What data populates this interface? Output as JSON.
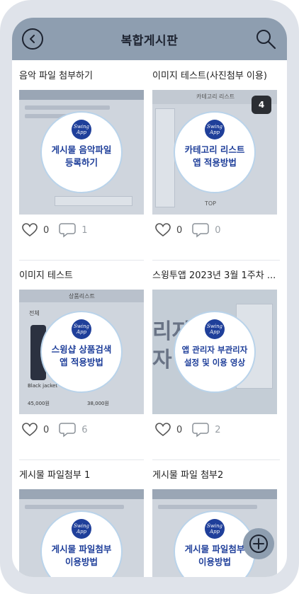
{
  "header": {
    "title": "복합게시판"
  },
  "posts": [
    {
      "title": "음악 파일 첨부하기",
      "badge_line1": "게시물 음악파일",
      "badge_line2": "등록하기",
      "likes": "0",
      "comments": "1",
      "count": ""
    },
    {
      "title": "이미지 테스트(사진첨부 이용)",
      "badge_line1": "카테고리 리스트",
      "badge_line2": "앱 적용방법",
      "likes": "0",
      "comments": "0",
      "count": "4"
    },
    {
      "title": "이미지 테스트",
      "badge_line1": "스윙샵 상품검색",
      "badge_line2": "앱 적용방법",
      "likes": "0",
      "comments": "6",
      "count": ""
    },
    {
      "title": "스윙투앱 2023년 3월 1주차 ...",
      "badge_line1": "앱 관리자 부관리자",
      "badge_line2": "설정 및 이용 영상",
      "likes": "0",
      "comments": "2",
      "count": ""
    },
    {
      "title": "게시물 파일첨부 1",
      "badge_line1": "게시물 파일첨부",
      "badge_line2": "이용방법",
      "likes": "",
      "comments": "",
      "count": ""
    },
    {
      "title": "게시물 파일 첨부2",
      "badge_line1": "게시물 파일첨부",
      "badge_line2": "이용방법",
      "likes": "",
      "comments": "",
      "count": ""
    }
  ],
  "logo": {
    "line1": "Swing",
    "line2": "App"
  },
  "thumb_texts": {
    "category_list": "카테고리 리스트",
    "top": "TOP",
    "product_list": "상품리스트",
    "all": "전체",
    "black_jacket": "Black jacket",
    "price1": "45,000원",
    "price2": "38,000원"
  },
  "colors": {
    "header": "#8e9eb0",
    "accent": "#1f3f9a",
    "frame": "#dfe3ea"
  },
  "icons": {
    "back": "back-circle-icon",
    "search": "search-icon",
    "like": "heart-icon",
    "comment": "comment-icon",
    "fab": "plus-circle-icon"
  }
}
